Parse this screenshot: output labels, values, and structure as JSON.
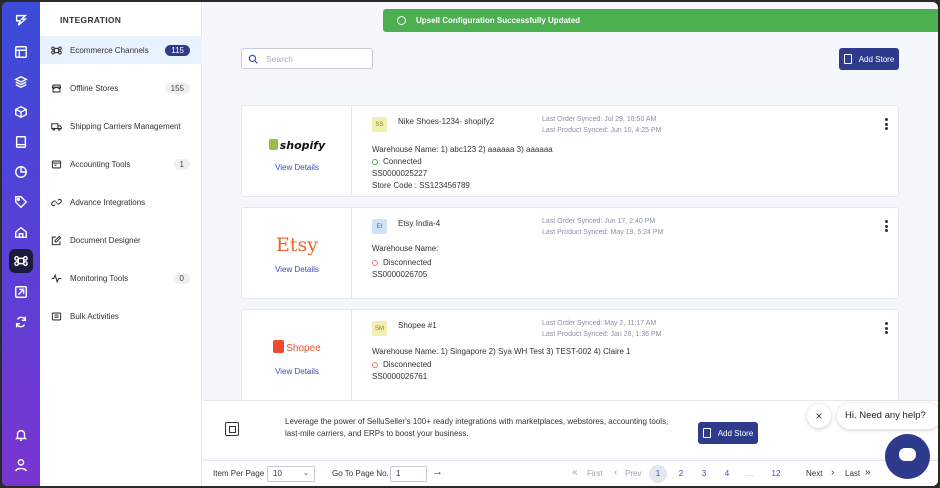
{
  "sidebar": {
    "title": "INTEGRATION",
    "items": [
      {
        "label": "Ecommerce Channels",
        "badge": "115",
        "icon": "command-icon"
      },
      {
        "label": "Offline Stores",
        "badge": "155",
        "icon": "store-icon"
      },
      {
        "label": "Shipping Carriers Management",
        "badge": "",
        "icon": "truck-icon"
      },
      {
        "label": "Accounting Tools",
        "badge": "1",
        "icon": "accounting-icon"
      },
      {
        "label": "Advance Integrations",
        "badge": "",
        "icon": "link-icon"
      },
      {
        "label": "Document Designer",
        "badge": "",
        "icon": "edit-icon"
      },
      {
        "label": "Monitoring Tools",
        "badge": "0",
        "icon": "pulse-icon"
      },
      {
        "label": "Bulk Activities",
        "badge": "",
        "icon": "bulk-icon"
      }
    ]
  },
  "toast": {
    "message": "Upsell Configuration Successfully Updated",
    "close": "×"
  },
  "search": {
    "placeholder": "Search"
  },
  "toolbar": {
    "add_store": "Add Store"
  },
  "stores": [
    {
      "logo": "shopify",
      "view": "View Details",
      "avatar": "SS",
      "avatar_color": "#f2efb3",
      "name": "Nike Shoes-1234- shopify2",
      "last_order": "Last Order Synced: Jul 29, 10:50 AM",
      "last_product": "Last Product Synced: Jun 10, 4:25 PM",
      "warehouse": "Warehouse Name: 1) abc123 2) aaaaaa 3) aaaaaa",
      "status": "Connected",
      "status_color": "#4caf50",
      "code": "SS0000025227",
      "store_code": "Store Code : SS123456789"
    },
    {
      "logo": "Etsy",
      "view": "View Details",
      "avatar": "EI",
      "avatar_color": "#cfe3f7",
      "name": "Etsy India-4",
      "last_order": "Last Order Synced: Jun 17, 2:40 PM",
      "last_product": "Last Product Synced: May 19, 5:24 PM",
      "warehouse": "Warehouse Name:",
      "status": "Disconnected",
      "status_color": "#ef7b7b",
      "code": "SS0000026705",
      "store_code": ""
    },
    {
      "logo": "Shopee",
      "view": "View Details",
      "avatar": "SM",
      "avatar_color": "#f2efb3",
      "name": "Shopee #1",
      "last_order": "Last Order Synced: May 2, 11:17 AM",
      "last_product": "Last Product Synced: Jan 26, 1:36 PM",
      "warehouse": "Warehouse Name: 1) Singapore 2) Sya WH Test 3) TEST-002 4) Claire 1",
      "status": "Disconnected",
      "status_color": "#ef7b7b",
      "code": "SS0000026761",
      "store_code": ""
    }
  ],
  "banner": {
    "text": "Leverage the power of SelluSeller's 100+ ready integrations with marketplaces, webstores, accounting tools, last-mile carriers, and ERPs to boost your business.",
    "button": "Add Store"
  },
  "pager": {
    "per_page_label": "Item Per Page",
    "per_page": "10",
    "goto_label": "Go To Page No.",
    "goto_value": "1",
    "first": "First",
    "prev": "Prev",
    "next": "Next",
    "last": "Last",
    "pages": [
      "1",
      "2",
      "3",
      "4",
      "...",
      "12"
    ],
    "current": "1"
  },
  "chat": {
    "greeting": "Hi. Need any help?",
    "close": "×"
  },
  "colors": {
    "accent": "#2e3a8c",
    "success": "#4caf50",
    "rail_top": "#3b4bd8",
    "rail_bottom": "#7a35d0"
  }
}
